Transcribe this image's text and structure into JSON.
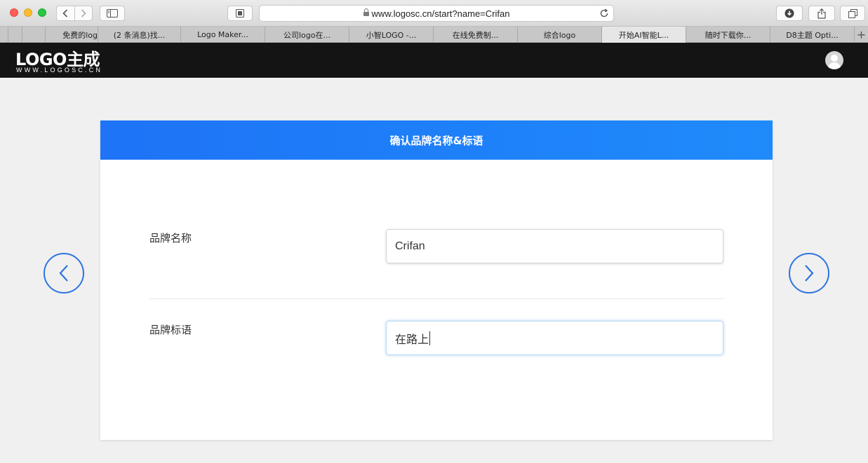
{
  "browser": {
    "url": "www.logosc.cn/start?name=Crifan",
    "tabs": [
      {
        "label": "免费的log",
        "active": false
      },
      {
        "label": "(2 条消息)找...",
        "active": false
      },
      {
        "label": "Logo Maker...",
        "active": false
      },
      {
        "label": "公司logo在...",
        "active": false
      },
      {
        "label": "小智LOGO -...",
        "active": false
      },
      {
        "label": "在线免费制...",
        "active": false
      },
      {
        "label": "综合logo",
        "active": false
      },
      {
        "label": "开始AI智能L...",
        "active": true
      },
      {
        "label": "随时下载你...",
        "active": false
      },
      {
        "label": "D8主题 Opti...",
        "active": false
      }
    ],
    "new_tab": "+"
  },
  "site": {
    "logo_main": "LOGO主成",
    "logo_sub": "WWW.LOGOSC.CN"
  },
  "card": {
    "title": "确认品牌名称&标语",
    "brand_name_label": "品牌名称",
    "brand_name_value": "Crifan",
    "slogan_label": "品牌标语",
    "slogan_value": "在路上"
  },
  "colors": {
    "accent": "#1e7ff8",
    "header_bg": "#141414",
    "arrow": "#2d74e0"
  },
  "icons": {
    "prev": "chevron-left-icon",
    "next": "chevron-right-icon"
  }
}
